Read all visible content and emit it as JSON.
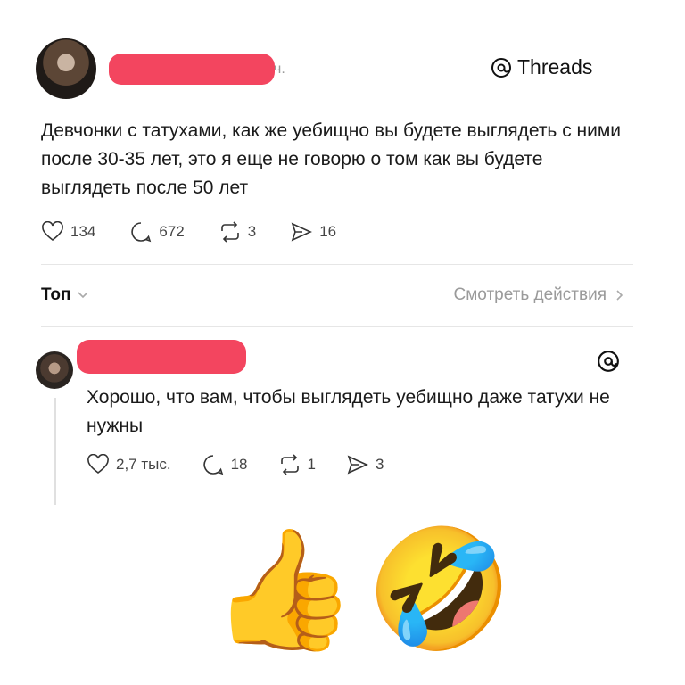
{
  "post": {
    "time_fragment": "ч.",
    "brand": "Threads",
    "text": "Девчонки с татухами, как же уебищно вы будете выглядеть с ними после 30-35 лет, это я еще не говорю о том как вы будете выглядеть после 50 лет",
    "stats": {
      "likes": "134",
      "comments": "672",
      "reposts": "3",
      "shares": "16"
    }
  },
  "filter": {
    "sort_label": "Топ",
    "view_activity": "Смотреть действия"
  },
  "reply": {
    "text": "Хорошо, что вам, чтобы выглядеть уебищно даже татухи не нужны",
    "stats": {
      "likes": "2,7 тыс.",
      "comments": "18",
      "reposts": "1",
      "shares": "3"
    }
  },
  "emoji": {
    "thumbs": "👍",
    "laugh": "🤣"
  },
  "icons": [
    "threads-logo-icon",
    "heart-icon",
    "comment-icon",
    "repost-icon",
    "share-icon",
    "chevron-down-icon",
    "chevron-right-icon"
  ],
  "colors": {
    "redaction": "#f3455f",
    "divider": "#e6e6e6",
    "muted": "#9a9a9a"
  }
}
